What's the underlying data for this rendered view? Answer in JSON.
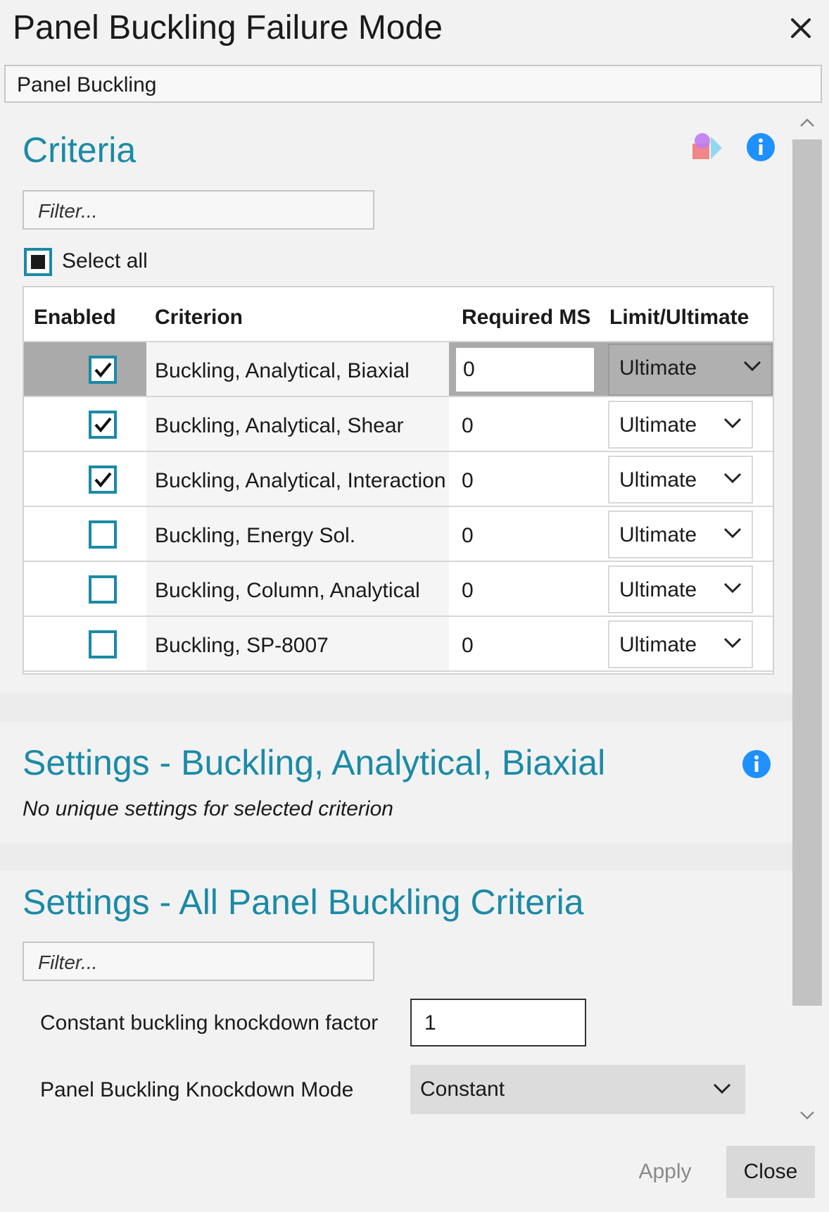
{
  "window": {
    "title": "Panel Buckling Failure Mode",
    "name_value": "Panel Buckling"
  },
  "criteria": {
    "title": "Criteria",
    "filter_placeholder": "Filter...",
    "select_all_label": "Select all",
    "columns": [
      "Enabled",
      "Criterion",
      "Required MS",
      "Limit/Ultimate"
    ],
    "rows": [
      {
        "enabled": true,
        "criterion": "Buckling, Analytical, Biaxial",
        "required_ms": "0",
        "limit_ultimate": "Ultimate",
        "selected": true
      },
      {
        "enabled": true,
        "criterion": "Buckling, Analytical, Shear",
        "required_ms": "0",
        "limit_ultimate": "Ultimate",
        "selected": false
      },
      {
        "enabled": true,
        "criterion": "Buckling, Analytical, Interaction",
        "required_ms": "0",
        "limit_ultimate": "Ultimate",
        "selected": false
      },
      {
        "enabled": false,
        "criterion": "Buckling, Energy Sol.",
        "required_ms": "0",
        "limit_ultimate": "Ultimate",
        "selected": false
      },
      {
        "enabled": false,
        "criterion": "Buckling, Column, Analytical",
        "required_ms": "0",
        "limit_ultimate": "Ultimate",
        "selected": false
      },
      {
        "enabled": false,
        "criterion": "Buckling, SP-8007",
        "required_ms": "0",
        "limit_ultimate": "Ultimate",
        "selected": false
      }
    ]
  },
  "settings_selected": {
    "title": "Settings - Buckling, Analytical, Biaxial",
    "message": "No unique settings for selected criterion"
  },
  "settings_all": {
    "title": "Settings - All Panel Buckling Criteria",
    "filter_placeholder": "Filter...",
    "knockdown_factor_label": "Constant buckling knockdown factor",
    "knockdown_factor_value": "1",
    "knockdown_mode_label": "Panel Buckling Knockdown Mode",
    "knockdown_mode_value": "Constant"
  },
  "footer": {
    "apply_label": "Apply",
    "close_label": "Close"
  },
  "colors": {
    "accent": "#1b8aa6",
    "info_icon": "#1e90ff",
    "selected_row": "#aaaaaa"
  },
  "icons": [
    "close-icon",
    "shapes-icon",
    "info-icon",
    "chevron-up-icon",
    "chevron-down-icon",
    "checkmark-icon"
  ]
}
